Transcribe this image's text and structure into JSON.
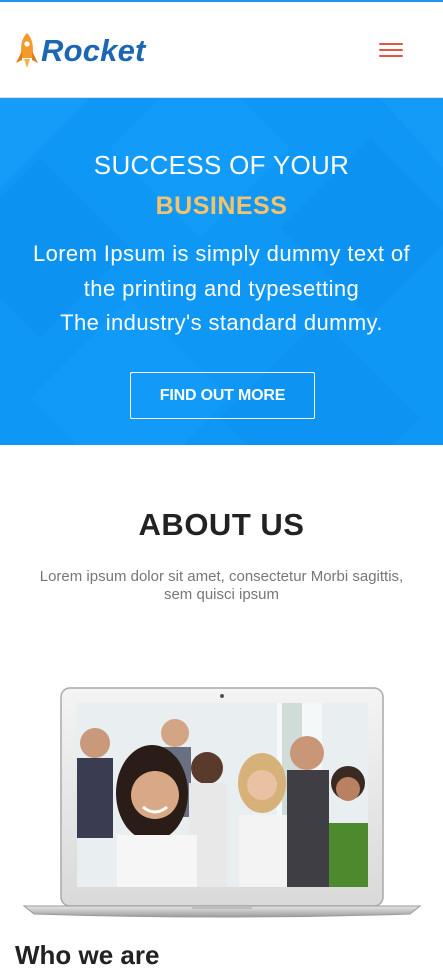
{
  "header": {
    "logo_text": "Rocket",
    "menu_label": "menu"
  },
  "hero": {
    "title": "SUCCESS OF YOUR",
    "highlight": "BUSINESS",
    "line1": "Lorem Ipsum is simply dummy text of",
    "line2": "the printing and typesetting",
    "line3": "The industry's standard dummy.",
    "cta_label": "FIND OUT MORE"
  },
  "about": {
    "title": "ABOUT US",
    "text_line1": "Lorem ipsum dolor sit amet, consectetur Morbi sagittis,",
    "text_line2": "sem quisci ipsum"
  },
  "who": {
    "title": "Who we are"
  },
  "colors": {
    "brand_blue": "#1b67b3",
    "hero_blue": "#0f97f6",
    "highlight_gold": "#f6c36b",
    "menu_red": "#e8553f",
    "rocket_orange": "#f39a2b"
  },
  "icons": {
    "logo": "rocket-icon",
    "menu": "hamburger-icon"
  }
}
